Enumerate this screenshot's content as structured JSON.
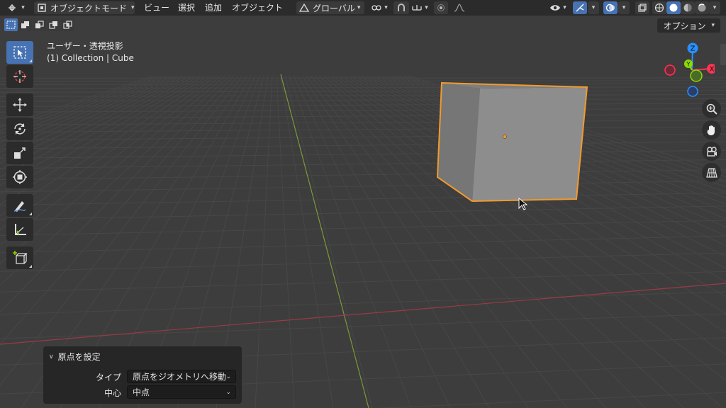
{
  "header": {
    "editor_type_icon": "viewport-editor-icon",
    "mode_label": "オブジェクトモード",
    "menus": [
      "ビュー",
      "選択",
      "追加",
      "オブジェクト"
    ],
    "orientation_label": "グローバル",
    "icons": [
      "transform-orientation-icon",
      "pivot-icon",
      "snap-icon",
      "snap-target-icon",
      "proportional-edit-icon",
      "falloff-icon",
      "visibility-icon",
      "gizmo-icon",
      "overlay-icon",
      "xray-icon",
      "wireframe-shading-icon",
      "solid-shading-icon",
      "material-shading-icon",
      "rendered-shading-icon"
    ]
  },
  "options_label": "オプション",
  "view_info": {
    "line1": "ユーザー・透視投影",
    "line2": "(1) Collection | Cube"
  },
  "toolbar": {
    "tools": [
      "select-box",
      "cursor",
      "move",
      "rotate",
      "scale",
      "transform",
      "annotate",
      "measure",
      "add-cube"
    ]
  },
  "gizmo": {
    "z": "Z",
    "y": "Y",
    "x": "X",
    "colors": {
      "x": "#ff3352",
      "y": "#8bdc00",
      "z": "#2890ff"
    }
  },
  "operator_panel": {
    "title": "原点を設定",
    "type_label": "タイプ",
    "type_value": "原点をジオメトリへ移動",
    "center_label": "中心",
    "center_value": "中点"
  },
  "colors": {
    "header_bg": "#2b2b2b",
    "viewport_bg": "#3d3d3d",
    "accent": "#4772b3",
    "selection_outline": "#f29a2e"
  }
}
